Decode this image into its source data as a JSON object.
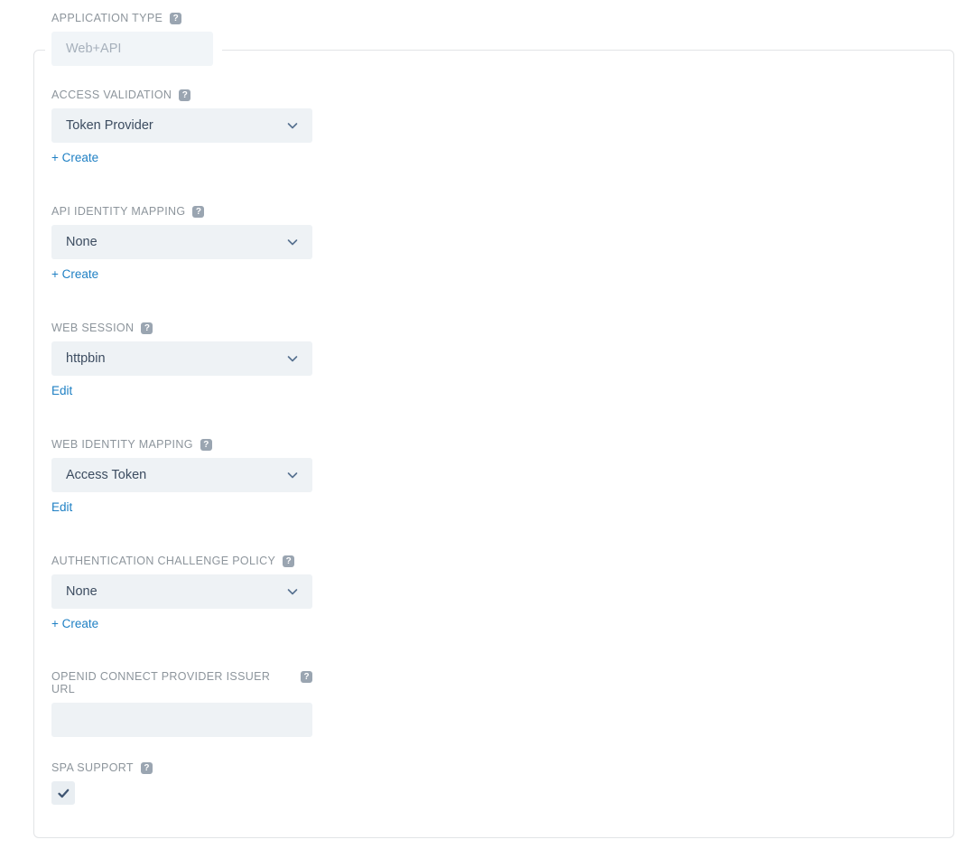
{
  "form": {
    "application_type": {
      "label": "APPLICATION TYPE",
      "help_icon": "help-circle-icon",
      "value": "Web+API",
      "disabled": true
    },
    "access_validation": {
      "label": "ACCESS VALIDATION",
      "help_icon": "help-circle-icon",
      "value": "Token Provider",
      "chevron": "chevron-down-icon",
      "action_label": "+ Create"
    },
    "api_identity_mapping": {
      "label": "API IDENTITY MAPPING",
      "help_icon": "help-circle-icon",
      "value": "None",
      "chevron": "chevron-down-icon",
      "action_label": "+ Create"
    },
    "web_session": {
      "label": "WEB SESSION",
      "help_icon": "help-circle-icon",
      "value": "httpbin",
      "chevron": "chevron-down-icon",
      "action_label": "Edit"
    },
    "web_identity_mapping": {
      "label": "WEB IDENTITY MAPPING",
      "help_icon": "help-circle-icon",
      "value": "Access Token",
      "chevron": "chevron-down-icon",
      "action_label": "Edit"
    },
    "authentication_challenge_policy": {
      "label": "AUTHENTICATION CHALLENGE POLICY",
      "help_icon": "help-circle-icon",
      "value": "None",
      "chevron": "chevron-down-icon",
      "action_label": "+ Create"
    },
    "openid_connect_provider_issuer_url": {
      "label": "OPENID CONNECT PROVIDER ISSUER URL",
      "help_icon": "help-circle-icon",
      "value": "",
      "placeholder": ""
    },
    "spa_support": {
      "label": "SPA SUPPORT",
      "help_icon": "help-circle-icon",
      "checked": true,
      "check_icon": "checkmark-icon"
    }
  },
  "icons": {
    "help": "?"
  },
  "colors": {
    "label": "#8d959c",
    "link": "#1f80c4",
    "field_background": "#eef2f5",
    "value_text": "#3c4c60",
    "help_badge": "#9aa5b1",
    "panel_border": "#e2e4e6",
    "checkmark": "#3f5572"
  }
}
